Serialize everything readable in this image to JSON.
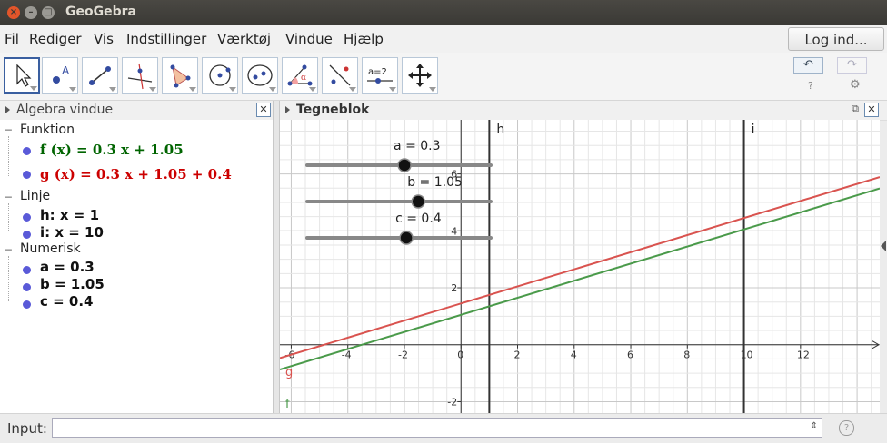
{
  "window": {
    "title": "GeoGebra"
  },
  "menu": {
    "items": [
      "Fil",
      "Rediger",
      "Vis",
      "Indstillinger",
      "Værktøj",
      "Vindue",
      "Hjælp"
    ],
    "login": "Log ind..."
  },
  "toolbar": {
    "tools": [
      "move",
      "point",
      "segment",
      "perpendicular-line",
      "polygon",
      "circle",
      "ellipse",
      "angle",
      "reflect",
      "slider",
      "move-view"
    ],
    "undo": "↶",
    "redo": "↷",
    "help": "?",
    "settings": "⚙",
    "slider_tool_label": "a=2"
  },
  "algebra": {
    "title": "Algebra vindue",
    "groups": [
      {
        "name": "Funktion",
        "items": [
          {
            "text": "f (x)  =  0.3 x + 1.05",
            "color": "#006400"
          },
          {
            "text": "g (x)  =  0.3 x + 1.05 + 0.4",
            "color": "#cc0000"
          }
        ]
      },
      {
        "name": "Linje",
        "items": [
          {
            "text": "h: x = 1",
            "color": "#111111"
          },
          {
            "text": "i: x = 10",
            "color": "#111111"
          }
        ]
      },
      {
        "name": "Numerisk",
        "items": [
          {
            "text": "a = 0.3",
            "color": "#111111"
          },
          {
            "text": "b = 1.05",
            "color": "#111111"
          },
          {
            "text": "c = 0.4",
            "color": "#111111"
          }
        ]
      }
    ]
  },
  "graphics": {
    "title": "Tegneblok",
    "x_range": [
      -6.4,
      14.8
    ],
    "y_range": [
      -2.4,
      7.9
    ],
    "x_ticks": [
      -6,
      -4,
      -2,
      0,
      2,
      4,
      6,
      8,
      10,
      12
    ],
    "y_ticks": [
      -2,
      2,
      4,
      6
    ],
    "sliders": [
      {
        "label": "a = 0.3",
        "min": -5,
        "max": 5,
        "value": 0.3
      },
      {
        "label": "b = 1.05",
        "min": -5,
        "max": 5,
        "value": 1.05
      },
      {
        "label": "c = 0.4",
        "min": -5,
        "max": 5,
        "value": 0.4
      }
    ],
    "functions": [
      {
        "name": "f",
        "slope": 0.3,
        "intercept": 1.05,
        "color": "#4a9a4a"
      },
      {
        "name": "g",
        "slope": 0.3,
        "intercept": 1.45,
        "color": "#d9534f"
      }
    ],
    "vlines": [
      {
        "name": "h",
        "x": 1
      },
      {
        "name": "i",
        "x": 10
      }
    ]
  },
  "input": {
    "label": "Input:",
    "value": "",
    "help": "?"
  }
}
